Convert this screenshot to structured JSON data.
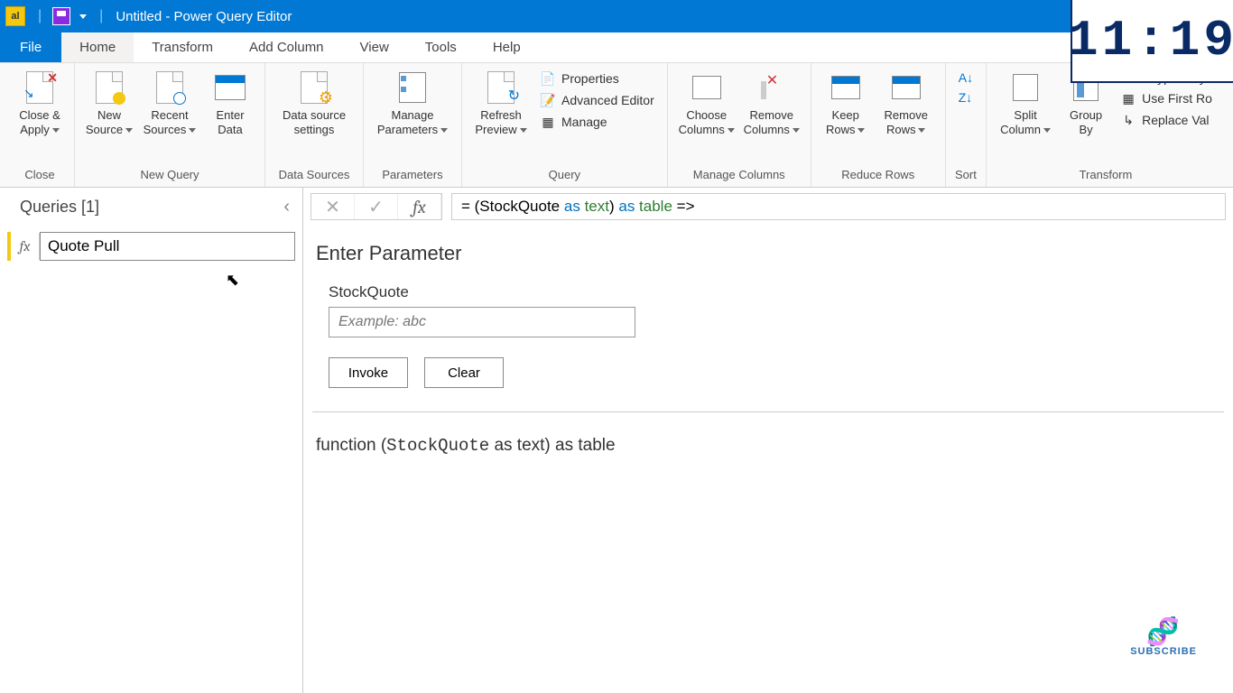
{
  "title_bar": {
    "title": "Untitled - Power Query Editor"
  },
  "menu": {
    "file": "File",
    "home": "Home",
    "transform": "Transform",
    "add_column": "Add Column",
    "view": "View",
    "tools": "Tools",
    "help": "Help"
  },
  "ribbon": {
    "close": {
      "label": "Close",
      "close_apply": "Close &\nApply"
    },
    "new_query": {
      "label": "New Query",
      "new_source": "New\nSource",
      "recent_sources": "Recent\nSources",
      "enter_data": "Enter\nData"
    },
    "data_sources": {
      "label": "Data Sources",
      "settings": "Data source\nsettings"
    },
    "parameters": {
      "label": "Parameters",
      "manage": "Manage\nParameters"
    },
    "query": {
      "label": "Query",
      "refresh": "Refresh\nPreview",
      "properties": "Properties",
      "advanced_editor": "Advanced Editor",
      "manage": "Manage"
    },
    "manage_columns": {
      "label": "Manage Columns",
      "choose": "Choose\nColumns",
      "remove": "Remove\nColumns"
    },
    "reduce_rows": {
      "label": "Reduce Rows",
      "keep": "Keep\nRows",
      "remove": "Remove\nRows"
    },
    "sort": {
      "label": "Sort",
      "az": "A↓Z",
      "za": "Z↓A"
    },
    "transform": {
      "label": "Transform",
      "split": "Split\nColumn",
      "group": "Group\nBy",
      "data_type": "Data Type: Any",
      "first_row": "Use First Ro",
      "replace": "Replace Val"
    }
  },
  "queries_panel": {
    "header": "Queries [1]",
    "item_icon": "fx",
    "item_name": "Quote Pull"
  },
  "formula_bar": {
    "fx": "fx",
    "formula_prefix": "= (StockQuote ",
    "formula_as1": "as",
    "formula_text": " text",
    "formula_paren": ") ",
    "formula_as2": "as",
    "formula_table": " table",
    "formula_arrow": " =>"
  },
  "main": {
    "heading": "Enter Parameter",
    "param_name": "StockQuote",
    "placeholder": "Example: abc",
    "invoke": "Invoke",
    "clear": "Clear",
    "signature_prefix": "function (",
    "signature_param": "StockQuote",
    "signature_suffix": " as text) as table"
  },
  "overlay": {
    "clock": "11:19",
    "subscribe": "SUBSCRIBE"
  }
}
